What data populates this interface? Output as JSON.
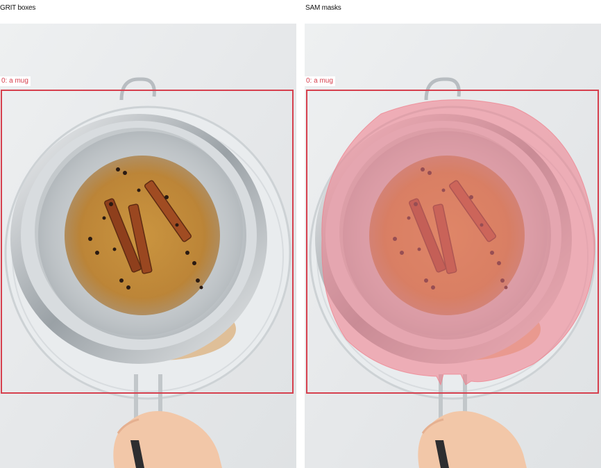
{
  "left_panel": {
    "title": "GRIT boxes",
    "label": "0: a mug"
  },
  "right_panel": {
    "title": "SAM masks",
    "label": "0: a mug"
  },
  "colors": {
    "box": "#d6404e",
    "mask": "#f07a88"
  }
}
